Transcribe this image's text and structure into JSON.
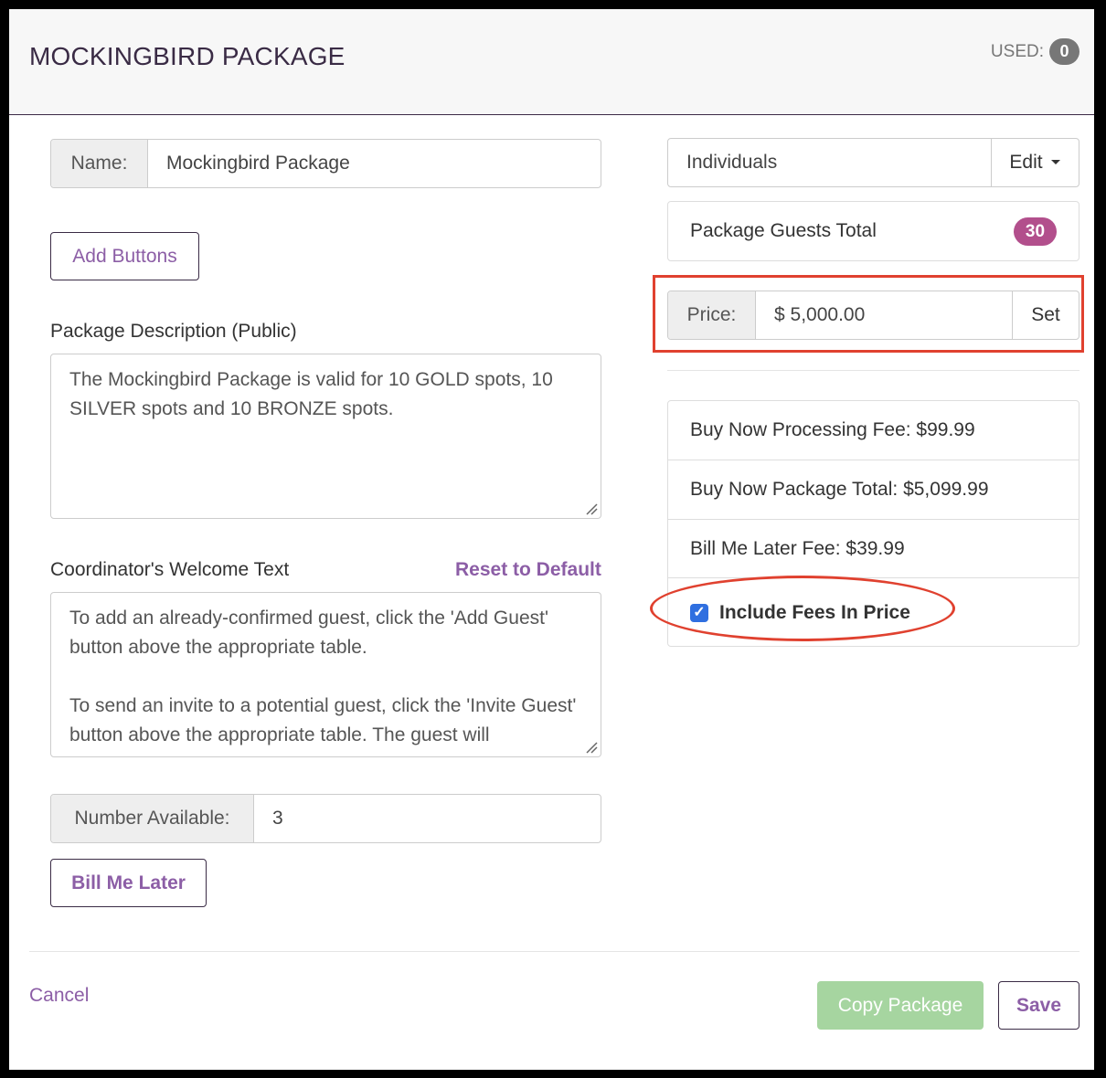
{
  "header": {
    "title": "MOCKINGBIRD PACKAGE",
    "used_label": "USED:",
    "used_count": "0"
  },
  "name_field": {
    "label": "Name:",
    "value": "Mockingbird Package"
  },
  "add_buttons_label": "Add Buttons",
  "description": {
    "label": "Package Description (Public)",
    "value": "The Mockingbird Package is valid for 10 GOLD spots, 10 SILVER spots and 10 BRONZE spots."
  },
  "welcome": {
    "label": "Coordinator's Welcome Text",
    "reset_label": "Reset to Default",
    "line1": "To add an already-confirmed guest, click the 'Add Guest' button above the appropriate table.",
    "line2": "To send an invite to a potential guest, click the 'Invite Guest' button above the appropriate table. The guest will"
  },
  "number_available": {
    "label": "Number Available:",
    "value": "3"
  },
  "bill_me_later_label": "Bill Me Later",
  "group": {
    "value": "Individuals",
    "edit_label": "Edit"
  },
  "guests_total": {
    "label": "Package Guests Total",
    "count": "30"
  },
  "price": {
    "label": "Price:",
    "value": "$ 5,000.00",
    "set_label": "Set"
  },
  "fees": {
    "processing": "Buy Now Processing Fee: $99.99",
    "package_total": "Buy Now Package Total: $5,099.99",
    "bill_later": "Bill Me Later Fee: $39.99",
    "include_fees_label": "Include Fees In Price",
    "include_fees_checked": true
  },
  "footer": {
    "cancel_label": "Cancel",
    "copy_label": "Copy Package",
    "save_label": "Save"
  },
  "colors": {
    "accent": "#8c5ea6",
    "badge_pink": "#b24f8c",
    "copy_green": "#a6d5a0",
    "annotation_red": "#e0412f"
  }
}
